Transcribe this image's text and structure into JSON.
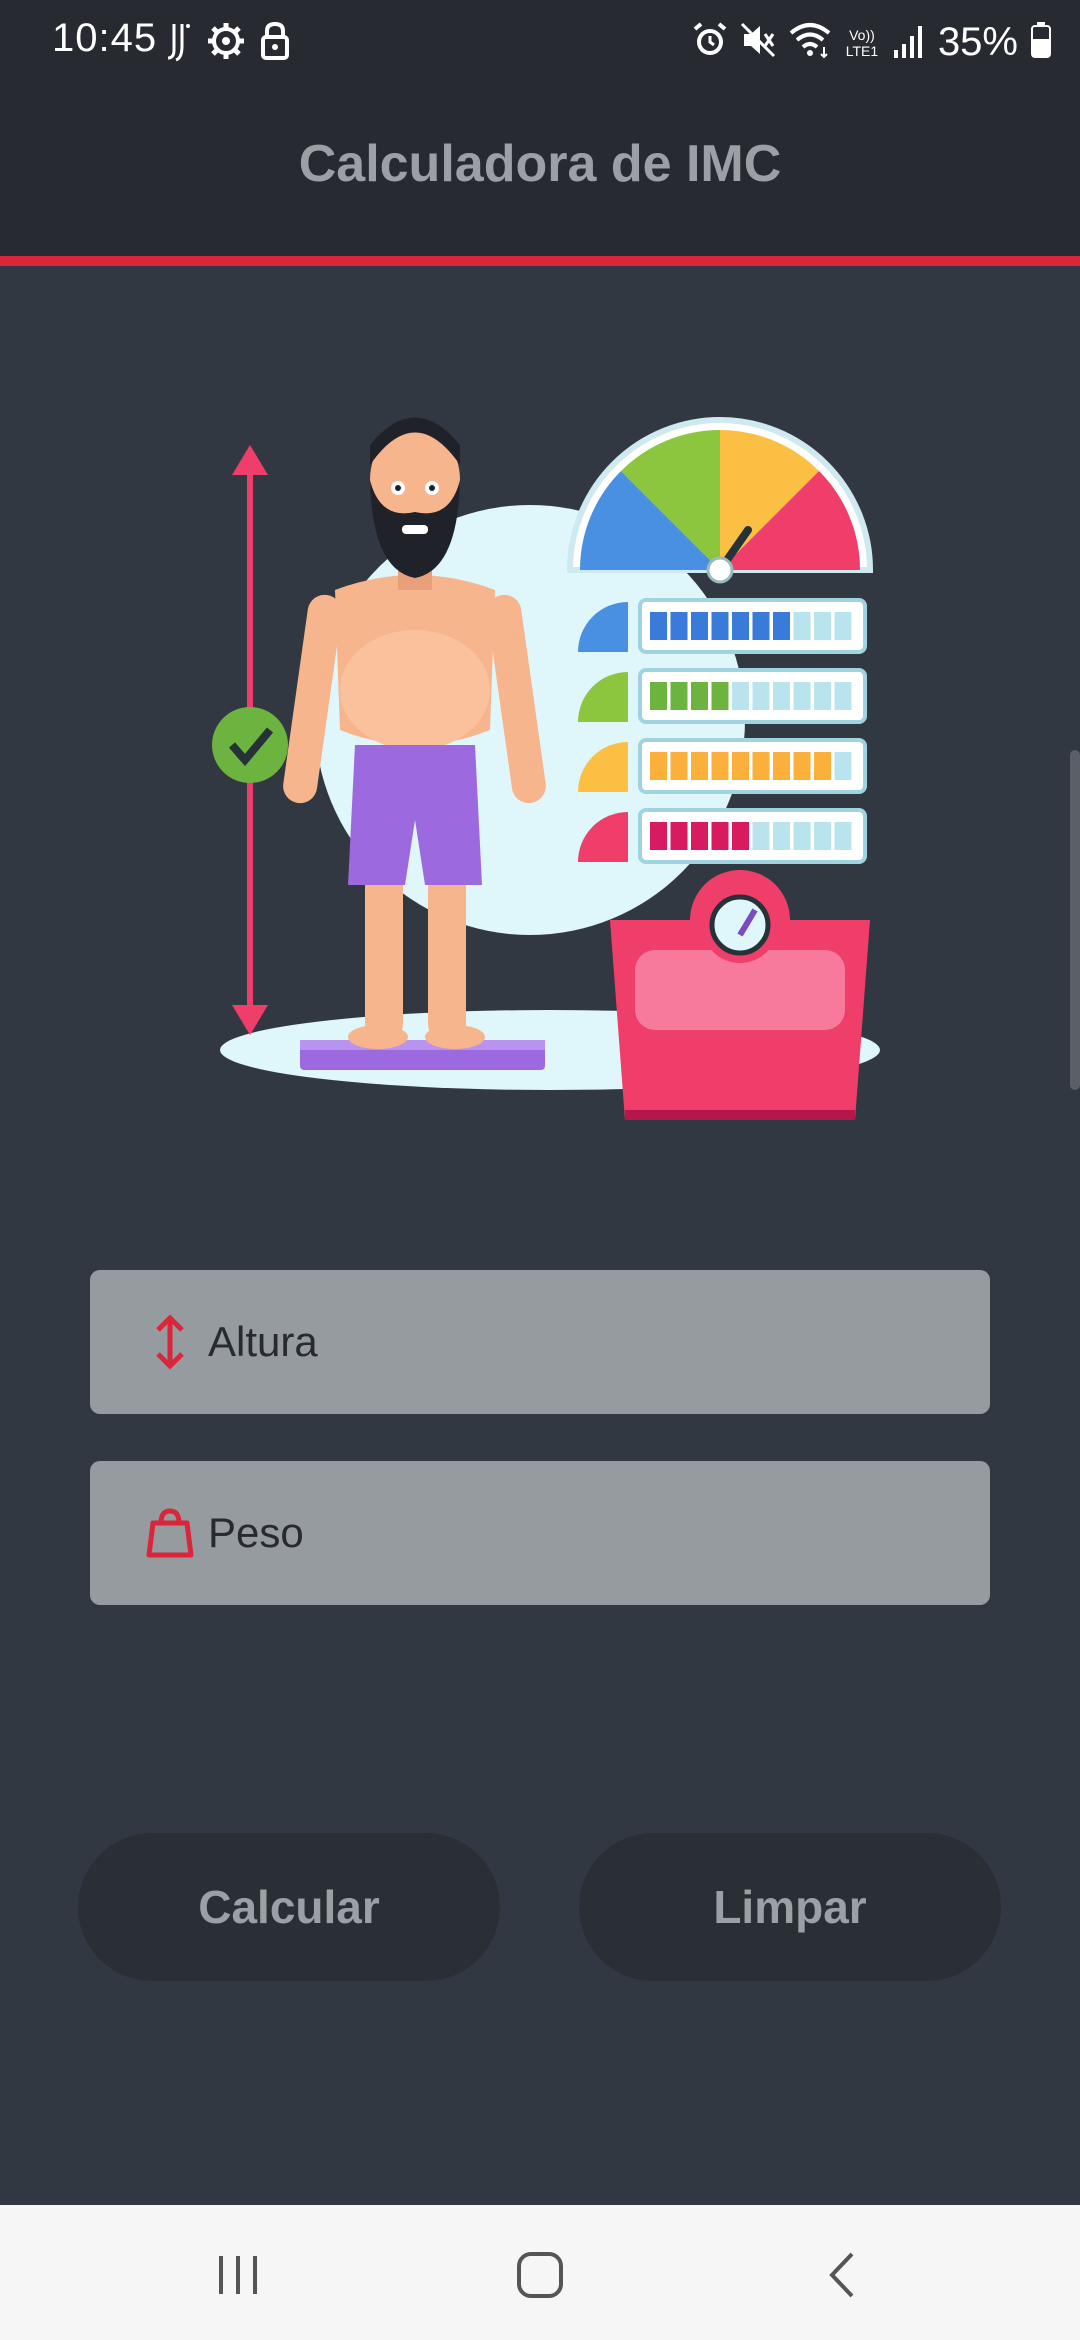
{
  "status_bar": {
    "time": "10:45",
    "battery_percent": "35%",
    "network_label": "Vo)) LTE1",
    "icons_left": [
      "handwriting-icon",
      "settings-gear-icon",
      "lock-icon"
    ],
    "icons_right": [
      "alarm-icon",
      "mute-icon",
      "wifi-icon",
      "volte-icon",
      "signal-icon",
      "battery-icon"
    ]
  },
  "app_bar": {
    "title": "Calculadora de IMC",
    "accent_color": "#d9263a"
  },
  "illustration": {
    "icon": "bmi-illustration",
    "gauge_colors": [
      "#4a90e2",
      "#8cc63f",
      "#fbbf44",
      "#ef3e6a"
    ],
    "level_bars": [
      {
        "color": "#3a7ad8",
        "filled": 7,
        "total": 10
      },
      {
        "color": "#6db33f",
        "filled": 4,
        "total": 10
      },
      {
        "color": "#fbb03b",
        "filled": 9,
        "total": 10
      },
      {
        "color": "#d81b60",
        "filled": 5,
        "total": 10
      }
    ]
  },
  "form": {
    "height_placeholder": "Altura",
    "height_icon": "vertical-arrows-icon",
    "weight_placeholder": "Peso",
    "weight_icon": "weight-bag-icon"
  },
  "actions": {
    "calculate_label": "Calcular",
    "clear_label": "Limpar"
  },
  "nav_bar": {
    "items": [
      "recent-apps-icon",
      "home-icon",
      "back-icon"
    ]
  }
}
